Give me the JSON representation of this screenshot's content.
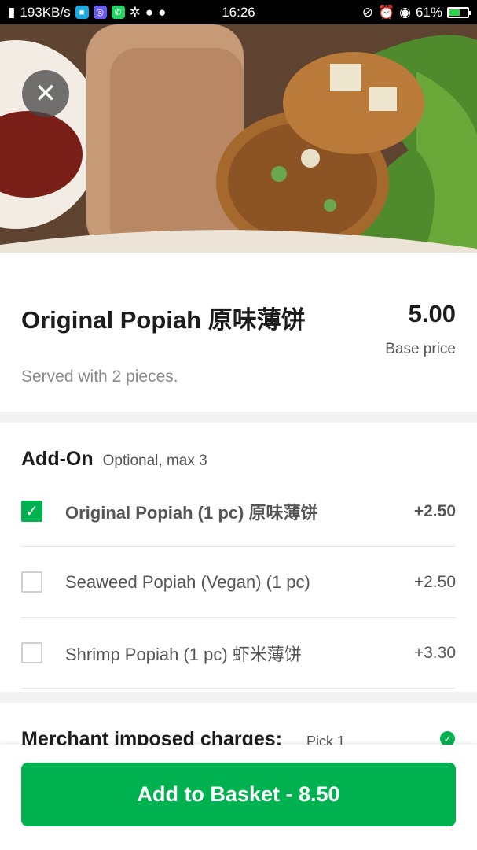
{
  "status_bar": {
    "network_speed": "193KB/s",
    "time": "16:26",
    "battery_text": "61%",
    "battery_level": 0.61
  },
  "item": {
    "title": "Original Popiah 原味薄饼",
    "price": "5.00",
    "base_price_label": "Base price",
    "description": "Served with 2 pieces."
  },
  "addons": {
    "title": "Add-On",
    "subtitle": "Optional, max 3",
    "options": [
      {
        "label": "Original Popiah (1 pc) 原味薄饼",
        "price": "+2.50",
        "checked": true
      },
      {
        "label": "Seaweed Popiah (Vegan) (1 pc)",
        "price": "+2.50",
        "checked": false
      },
      {
        "label": "Shrimp Popiah (1 pc) 虾米薄饼",
        "price": "+3.30",
        "checked": false
      }
    ]
  },
  "merchant": {
    "title": "Merchant imposed charges:",
    "subtitle": "Pick 1"
  },
  "footer": {
    "cta_label": "Add to Basket - 8.50"
  },
  "colors": {
    "accent": "#00b14f",
    "text_primary": "#1c1c1c",
    "text_secondary": "#555555",
    "text_muted": "#8a8a8a",
    "divider_band": "#f3f3f3"
  },
  "icons": {
    "close": "close-icon",
    "check": "check-icon"
  }
}
